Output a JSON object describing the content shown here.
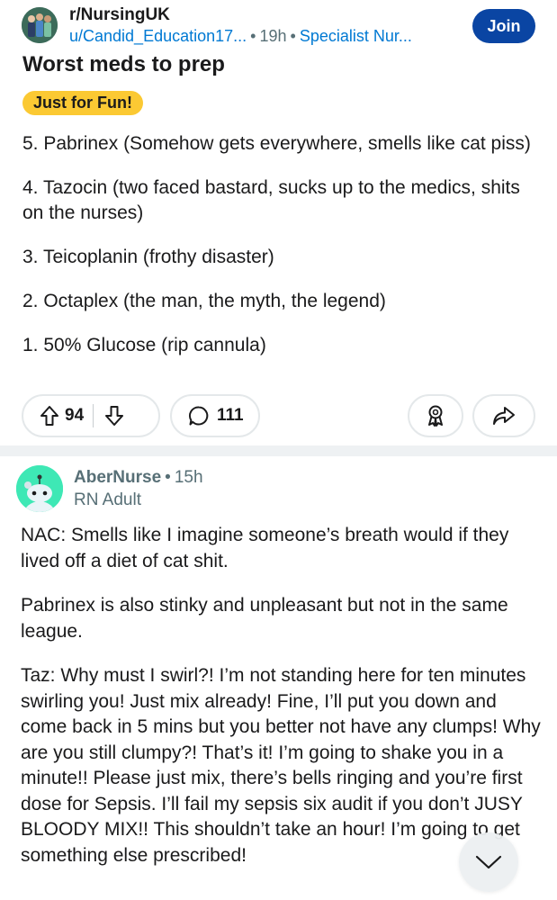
{
  "post": {
    "subreddit": "r/NursingUK",
    "author": "u/Candid_Education17...",
    "time": "19h",
    "flair_category": "Specialist Nur...",
    "join_label": "Join",
    "title": "Worst meds to prep",
    "flair": "Just for Fun!",
    "body": [
      "5. Pabrinex (Somehow gets everywhere, smells like cat piss)",
      "4. Tazocin (two faced bastard, sucks up to the medics, shits on the nurses)",
      "3. Teicoplanin (frothy disaster)",
      "2. Octaplex (the man, the myth, the legend)",
      "1. 50% Glucose (rip cannula)"
    ],
    "upvotes": "94",
    "comments": "111"
  },
  "comment": {
    "author": "AberNurse",
    "time": "15h",
    "user_flair": "RN Adult",
    "body": [
      "NAC: Smells like I imagine someone’s breath would if they lived off a diet of cat shit.",
      "Pabrinex is also stinky and unpleasant but not in the same league.",
      "Taz: Why must I swirl?! I’m not standing here for ten minutes swirling you! Just mix already! Fine, I’ll put you down and come back in 5 mins but you better not have any clumps! Why are you still clumpy?! That’s it! I’m going to shake you in a minute!! Please just mix, there’s bells ringing and you’re first dose for Sepsis. I’ll fail my sepsis six audit if you don’t JUSY BLOODY MIX!! This shouldn’t take an hour! I’m going to get something else prescribed!"
    ]
  },
  "icons": [
    "upvote-icon",
    "downvote-icon",
    "comment-icon",
    "award-icon",
    "share-icon",
    "chevron-down-icon"
  ],
  "colors": {
    "join": "#0a45a3",
    "link": "#0079d3",
    "flair": "#fbc933",
    "meta": "#576f76",
    "comment_avatar": "#3ee8b5"
  }
}
